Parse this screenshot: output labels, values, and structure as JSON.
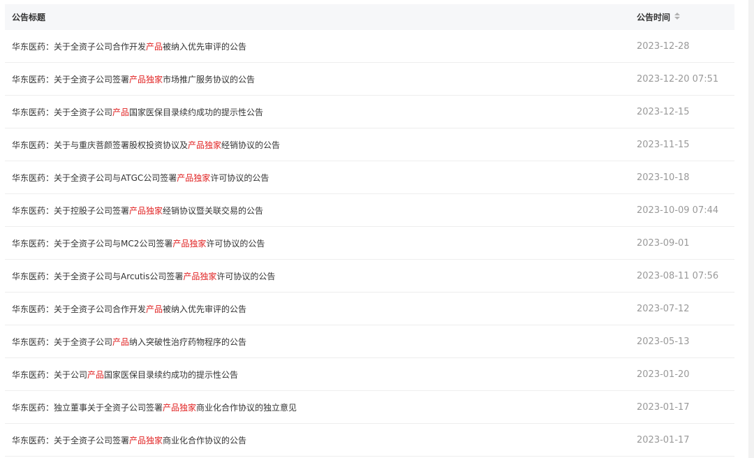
{
  "header": {
    "title_label": "公告标题",
    "time_label": "公告时间"
  },
  "rows": [
    {
      "parts": [
        "华东医药：关于全资子公司合作开发",
        "产品",
        "被纳入优先审评的公告"
      ],
      "time": "2023-12-28"
    },
    {
      "parts": [
        "华东医药：关于全资子公司签署",
        "产品独家",
        "市场推广服务协议的公告"
      ],
      "time": "2023-12-20 07:51"
    },
    {
      "parts": [
        "华东医药：关于全资子公司",
        "产品",
        "国家医保目录续约成功的提示性公告"
      ],
      "time": "2023-12-15"
    },
    {
      "parts": [
        "华东医药：关于与重庆菩颜签署股权投资协议及",
        "产品独家",
        "经销协议的公告"
      ],
      "time": "2023-11-15"
    },
    {
      "parts": [
        "华东医药：关于全资子公司与ATGC公司签署",
        "产品独家",
        "许可协议的公告"
      ],
      "time": "2023-10-18"
    },
    {
      "parts": [
        "华东医药：关于控股子公司签署",
        "产品独家",
        "经销协议暨关联交易的公告"
      ],
      "time": "2023-10-09 07:44"
    },
    {
      "parts": [
        "华东医药：关于全资子公司与MC2公司签署",
        "产品独家",
        "许可协议的公告"
      ],
      "time": "2023-09-01"
    },
    {
      "parts": [
        "华东医药：关于全资子公司与Arcutis公司签署",
        "产品独家",
        "许可协议的公告"
      ],
      "time": "2023-08-11 07:56"
    },
    {
      "parts": [
        "华东医药：关于全资子公司合作开发",
        "产品",
        "被纳入优先审评的公告"
      ],
      "time": "2023-07-12"
    },
    {
      "parts": [
        "华东医药：关于全资子公司",
        "产品",
        "纳入突破性治疗药物程序的公告"
      ],
      "time": "2023-05-13"
    },
    {
      "parts": [
        "华东医药：关于公司",
        "产品",
        "国家医保目录续约成功的提示性公告"
      ],
      "time": "2023-01-20"
    },
    {
      "parts": [
        "华东医药：独立董事关于全资子公司签署",
        "产品独家",
        "商业化合作协议的独立意见"
      ],
      "time": "2023-01-17"
    },
    {
      "parts": [
        "华东医药：关于全资子公司签署",
        "产品独家",
        "商业化合作协议的公告"
      ],
      "time": "2023-01-17"
    }
  ],
  "colors": {
    "highlight": "#e02020",
    "time_text": "#999999",
    "header_bg": "#f6f7f9"
  },
  "icons": {
    "sort": "sort-icon"
  }
}
